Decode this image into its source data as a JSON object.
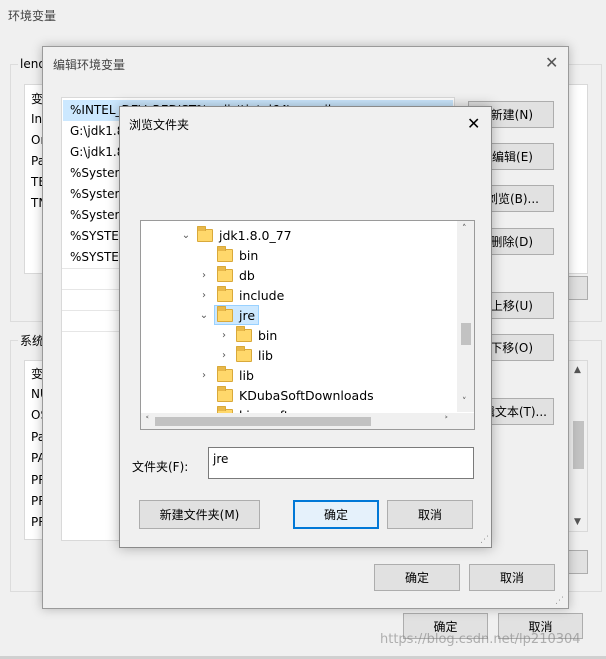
{
  "env_window": {
    "title": "环境变量",
    "user_group_label": "leno",
    "user_rows": [
      "变",
      "Int",
      "On",
      "Pa",
      "TE",
      "TN"
    ],
    "system_group_label": "系统",
    "system_rows": [
      "变",
      "NU",
      "OS",
      "Pa",
      "PA",
      "PR",
      "PR",
      "PR"
    ],
    "ok_label": "确定",
    "cancel_label": "取消"
  },
  "edit_window": {
    "title": "编辑环境变量",
    "entries": [
      "%INTEL_DEV_REDIST%redist\\intel64\\compiler",
      "G:\\jdk1.8",
      "G:\\jdk1.8",
      "%System",
      "%System",
      "%System",
      "%SYSTEM",
      "%SYSTEM"
    ],
    "buttons": {
      "new": "新建(N)",
      "edit": "编辑(E)",
      "browse": "浏览(B)...",
      "delete": "删除(D)",
      "move_up": "上移(U)",
      "move_down": "下移(O)",
      "edit_text": "辑文本(T)..."
    },
    "ok_label": "确定",
    "cancel_label": "取消"
  },
  "browse_dialog": {
    "title": "浏览文件夹",
    "tree": [
      {
        "label": "jdk1.8.0_77",
        "depth": 0,
        "chevron": "down"
      },
      {
        "label": "bin",
        "depth": 1,
        "chevron": "none"
      },
      {
        "label": "db",
        "depth": 1,
        "chevron": "right"
      },
      {
        "label": "include",
        "depth": 1,
        "chevron": "right"
      },
      {
        "label": "jre",
        "depth": 1,
        "chevron": "down",
        "selected": true
      },
      {
        "label": "bin",
        "depth": 2,
        "chevron": "right"
      },
      {
        "label": "lib",
        "depth": 2,
        "chevron": "right"
      },
      {
        "label": "lib",
        "depth": 1,
        "chevron": "right"
      },
      {
        "label": "KDubaSoftDownloads",
        "depth": -1,
        "chevron": "none"
      },
      {
        "label": "kingsoft",
        "depth": -1,
        "chevron": "right"
      }
    ],
    "folder_label": "文件夹(F):",
    "folder_value": "jre",
    "new_folder_label": "新建文件夹(M)",
    "ok_label": "确定",
    "cancel_label": "取消"
  },
  "watermark": "https://blog.csdn.net/lp210304",
  "colors": {
    "selection": "#cce8ff",
    "selection_border": "#99d1ff",
    "primary_border": "#0078d7"
  }
}
